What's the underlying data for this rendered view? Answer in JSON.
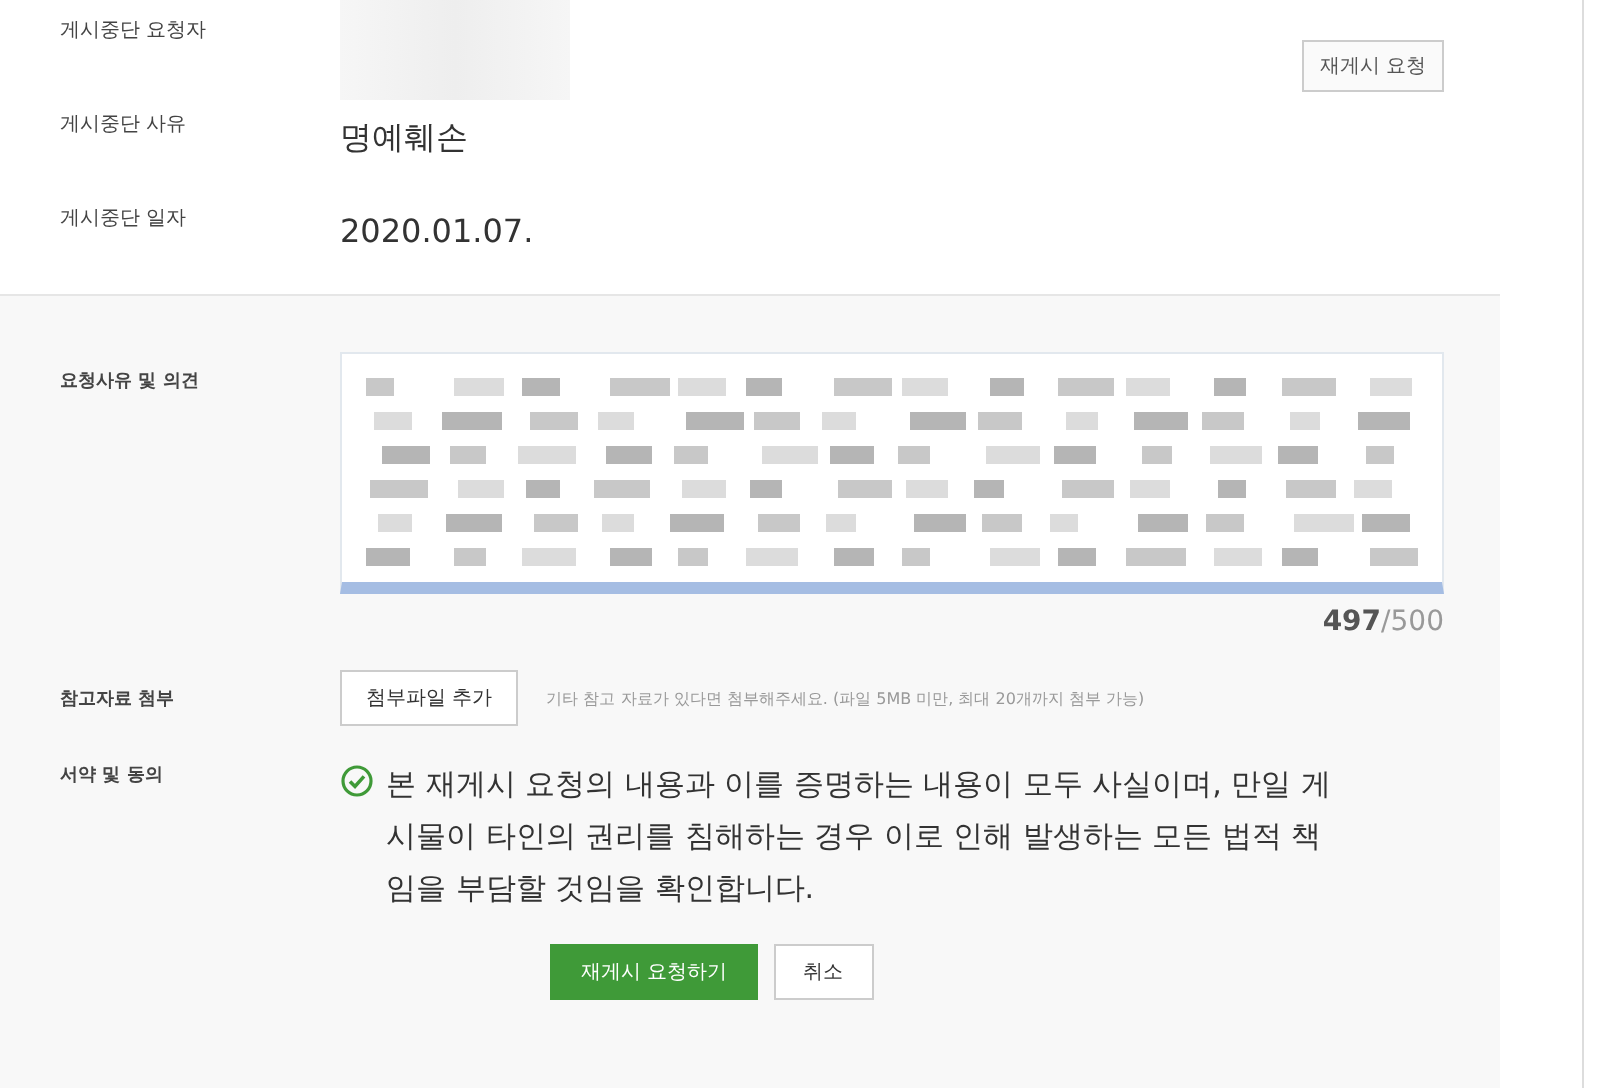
{
  "info_rows": [
    {
      "label": "게시중단 요청자",
      "kind": "redacted"
    },
    {
      "label": "게시중단 사유",
      "kind": "text",
      "value": "명예훼손"
    },
    {
      "label": "게시중단 일자",
      "kind": "text",
      "value": "2020.01.07."
    }
  ],
  "repost_button": "재게시 요청",
  "opinion": {
    "label": "요청사유 및 의견",
    "count": "497",
    "max": "/500"
  },
  "attachment": {
    "label": "참고자료 첨부",
    "button": "첨부파일 추가",
    "hint": "기타 참고 자료가 있다면 첨부해주세요. (파일 5MB 미만, 최대 20개까지 첨부 가능)"
  },
  "agreement": {
    "label": "서약 및 동의",
    "checked": true,
    "text": "본 재게시 요청의 내용과 이를 증명하는 내용이 모두 사실이며, 만일 게시물이 타인의 권리를 침해하는 경우 이로 인해 발생하는 모든 법적 책임을 부담할 것임을 확인합니다."
  },
  "actions": [
    {
      "label": "재게시 요청하기",
      "kind": "primary"
    },
    {
      "label": "취소",
      "kind": "secondary"
    }
  ]
}
